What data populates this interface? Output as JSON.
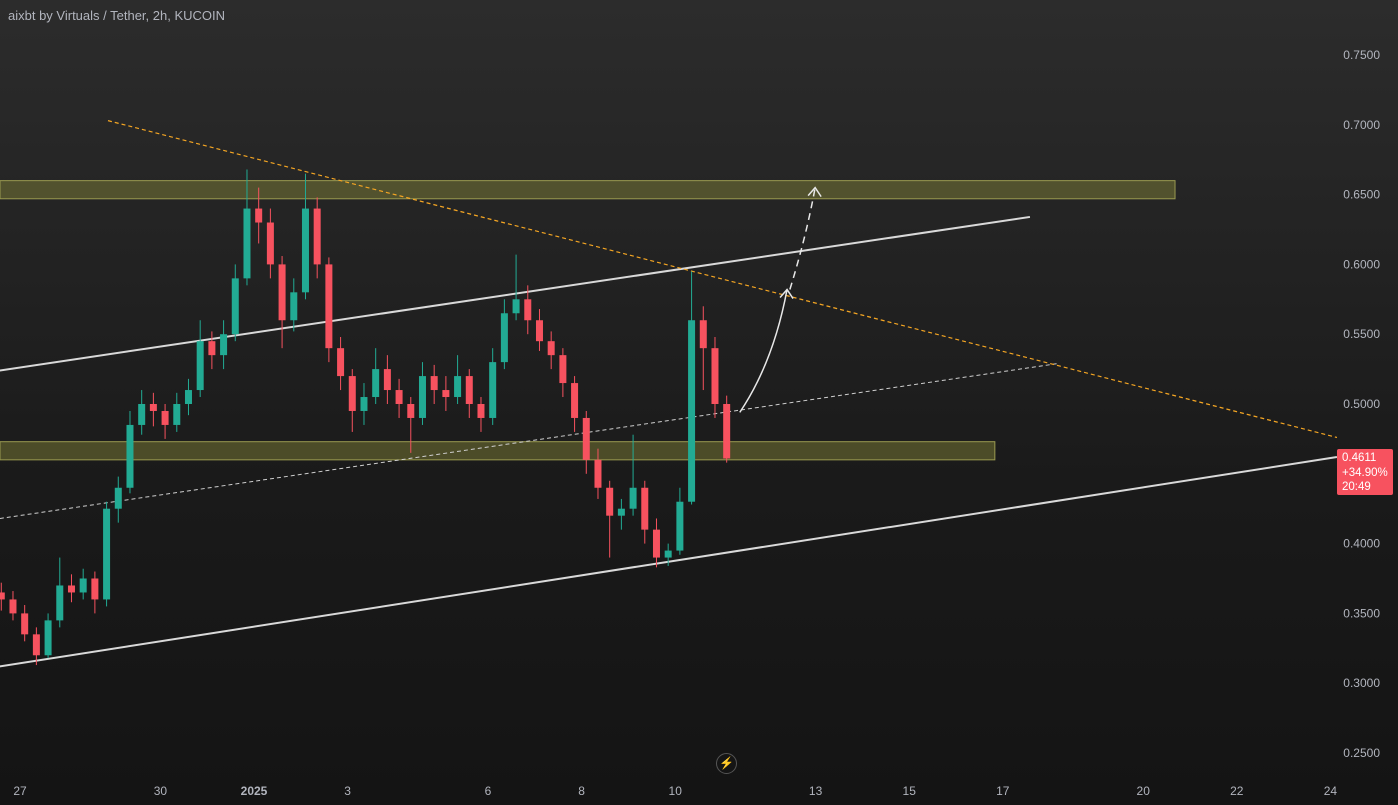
{
  "header": {
    "title": "aixbt by Virtuals / Tether, 2h, KUCOIN"
  },
  "last_price": {
    "price": "0.4611",
    "change": "+34.90%",
    "countdown": "20:49"
  },
  "colors": {
    "up": "#22ab94",
    "down": "#f7525f",
    "zone": "#8a8a3a",
    "trend": "#f5a623",
    "channel": "#d9d9d9"
  },
  "chart_data": {
    "type": "candlestick",
    "title": "aixbt by Virtuals / Tether, 2h, KUCOIN",
    "start_day": -0.4,
    "step_days": 0.25,
    "candles": [
      [
        0.365,
        0.372,
        0.352,
        0.36
      ],
      [
        0.36,
        0.366,
        0.345,
        0.35
      ],
      [
        0.35,
        0.356,
        0.33,
        0.335
      ],
      [
        0.335,
        0.34,
        0.313,
        0.32
      ],
      [
        0.32,
        0.35,
        0.318,
        0.345
      ],
      [
        0.345,
        0.39,
        0.34,
        0.37
      ],
      [
        0.37,
        0.378,
        0.358,
        0.365
      ],
      [
        0.365,
        0.382,
        0.36,
        0.375
      ],
      [
        0.375,
        0.38,
        0.35,
        0.36
      ],
      [
        0.36,
        0.43,
        0.355,
        0.425
      ],
      [
        0.425,
        0.448,
        0.415,
        0.44
      ],
      [
        0.44,
        0.495,
        0.436,
        0.485
      ],
      [
        0.485,
        0.51,
        0.478,
        0.5
      ],
      [
        0.5,
        0.508,
        0.484,
        0.495
      ],
      [
        0.495,
        0.5,
        0.475,
        0.485
      ],
      [
        0.485,
        0.508,
        0.48,
        0.5
      ],
      [
        0.5,
        0.518,
        0.492,
        0.51
      ],
      [
        0.51,
        0.56,
        0.505,
        0.545
      ],
      [
        0.545,
        0.552,
        0.525,
        0.535
      ],
      [
        0.535,
        0.56,
        0.525,
        0.55
      ],
      [
        0.55,
        0.6,
        0.545,
        0.59
      ],
      [
        0.59,
        0.668,
        0.585,
        0.64
      ],
      [
        0.64,
        0.655,
        0.615,
        0.63
      ],
      [
        0.63,
        0.64,
        0.59,
        0.6
      ],
      [
        0.6,
        0.606,
        0.54,
        0.56
      ],
      [
        0.56,
        0.59,
        0.552,
        0.58
      ],
      [
        0.58,
        0.665,
        0.575,
        0.64
      ],
      [
        0.64,
        0.648,
        0.59,
        0.6
      ],
      [
        0.6,
        0.605,
        0.53,
        0.54
      ],
      [
        0.54,
        0.548,
        0.51,
        0.52
      ],
      [
        0.52,
        0.525,
        0.48,
        0.495
      ],
      [
        0.495,
        0.515,
        0.485,
        0.505
      ],
      [
        0.505,
        0.54,
        0.5,
        0.525
      ],
      [
        0.525,
        0.535,
        0.5,
        0.51
      ],
      [
        0.51,
        0.518,
        0.49,
        0.5
      ],
      [
        0.5,
        0.505,
        0.465,
        0.49
      ],
      [
        0.49,
        0.53,
        0.485,
        0.52
      ],
      [
        0.52,
        0.528,
        0.5,
        0.51
      ],
      [
        0.51,
        0.52,
        0.495,
        0.505
      ],
      [
        0.505,
        0.535,
        0.5,
        0.52
      ],
      [
        0.52,
        0.525,
        0.49,
        0.5
      ],
      [
        0.5,
        0.505,
        0.48,
        0.49
      ],
      [
        0.49,
        0.54,
        0.485,
        0.53
      ],
      [
        0.53,
        0.575,
        0.525,
        0.565
      ],
      [
        0.565,
        0.607,
        0.56,
        0.575
      ],
      [
        0.575,
        0.585,
        0.55,
        0.56
      ],
      [
        0.56,
        0.568,
        0.538,
        0.545
      ],
      [
        0.545,
        0.552,
        0.525,
        0.535
      ],
      [
        0.535,
        0.54,
        0.505,
        0.515
      ],
      [
        0.515,
        0.52,
        0.48,
        0.49
      ],
      [
        0.49,
        0.495,
        0.45,
        0.46
      ],
      [
        0.46,
        0.468,
        0.432,
        0.44
      ],
      [
        0.44,
        0.445,
        0.39,
        0.42
      ],
      [
        0.42,
        0.432,
        0.41,
        0.425
      ],
      [
        0.425,
        0.478,
        0.42,
        0.44
      ],
      [
        0.44,
        0.445,
        0.4,
        0.41
      ],
      [
        0.41,
        0.418,
        0.383,
        0.39
      ],
      [
        0.39,
        0.4,
        0.384,
        0.395
      ],
      [
        0.395,
        0.44,
        0.392,
        0.43
      ],
      [
        0.43,
        0.595,
        0.428,
        0.56
      ],
      [
        0.56,
        0.57,
        0.51,
        0.54
      ],
      [
        0.54,
        0.548,
        0.49,
        0.5
      ],
      [
        0.5,
        0.506,
        0.458,
        0.461
      ]
    ],
    "yaxis": {
      "ticks": [
        "0.7500",
        "0.7000",
        "0.6500",
        "0.6000",
        "0.5500",
        "0.5000",
        "0.4000",
        "0.3500",
        "0.3000",
        "0.2500"
      ],
      "tick_values": [
        0.75,
        0.7,
        0.65,
        0.6,
        0.55,
        0.5,
        0.4,
        0.35,
        0.3,
        0.25
      ],
      "range": [
        0.25,
        0.75
      ]
    },
    "xaxis": {
      "ticks": [
        "27",
        "30",
        "2025",
        "3",
        "6",
        "8",
        "10",
        "13",
        "15",
        "17",
        "20",
        "22",
        "24"
      ],
      "tick_days": [
        0,
        3,
        5,
        7,
        10,
        12,
        14,
        17,
        19,
        21,
        24,
        26,
        28
      ]
    },
    "drawings": {
      "zones": [
        {
          "top": 0.66,
          "bottom": 0.647,
          "end_day": 24.68
        },
        {
          "top": 0.473,
          "bottom": 0.46,
          "end_day": 20.83
        }
      ],
      "channel_upper": [
        [
          -0.43,
          0.524
        ],
        [
          21.58,
          0.634
        ]
      ],
      "channel_lower": [
        [
          -0.43,
          0.312
        ],
        [
          28.14,
          0.462
        ]
      ],
      "channel_mid": [
        [
          -0.43,
          0.418
        ],
        [
          22.18,
          0.529
        ]
      ],
      "trendline": [
        [
          1.88,
          0.703
        ],
        [
          28.14,
          0.476
        ]
      ],
      "arrow_solid": [
        [
          15.38,
          0.494
        ],
        [
          16.1,
          0.53
        ],
        [
          16.39,
          0.582
        ]
      ],
      "arrow_dashed": [
        [
          16.45,
          0.582
        ],
        [
          16.8,
          0.62
        ],
        [
          16.99,
          0.655
        ]
      ]
    }
  }
}
